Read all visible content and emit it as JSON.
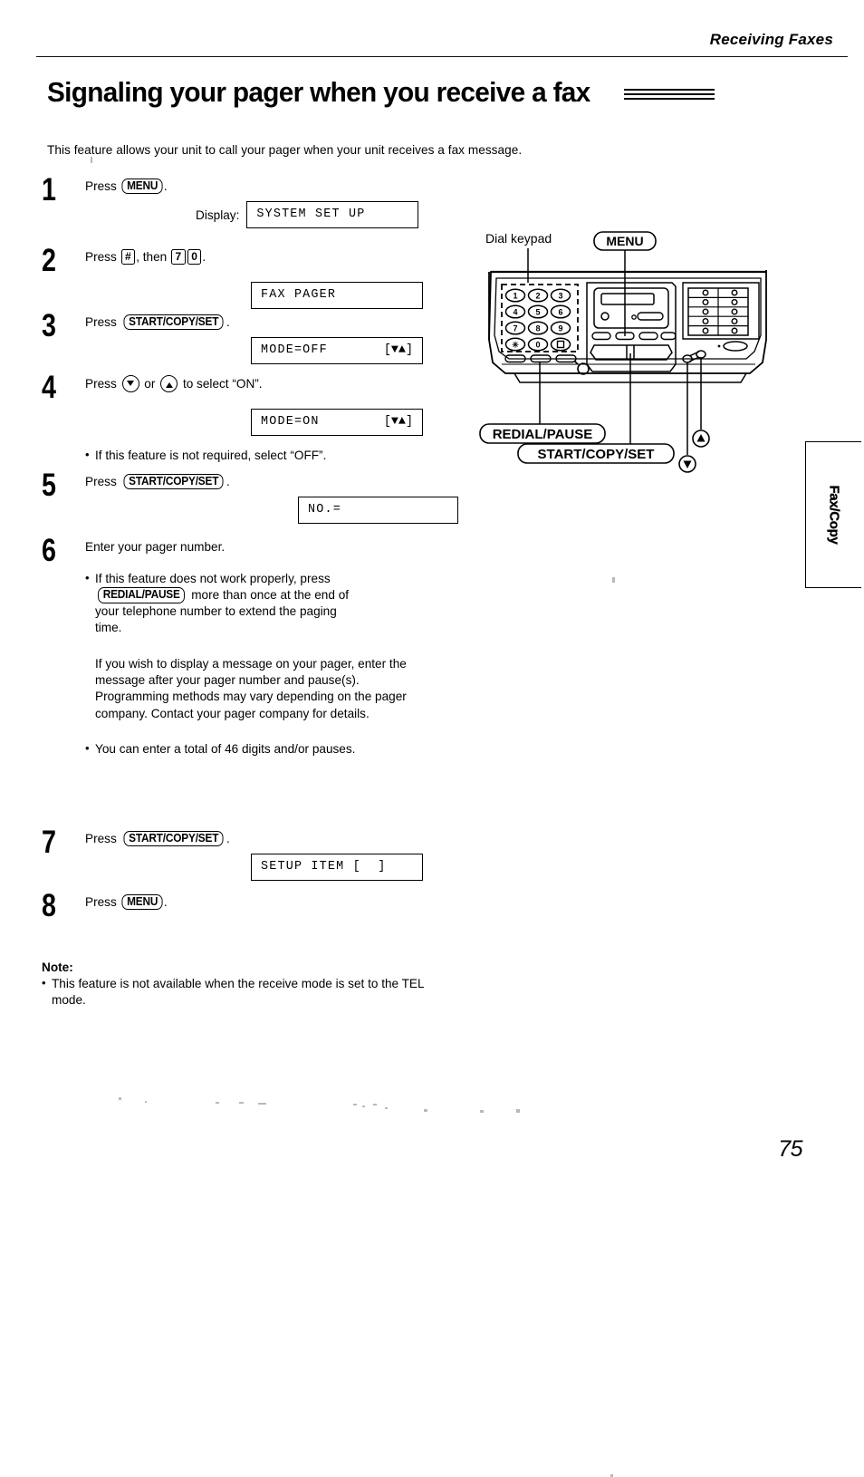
{
  "header": {
    "section_title": "Receiving Faxes"
  },
  "title": "Signaling your pager when you receive a fax",
  "intro": "This feature allows your unit to call your pager when your unit receives a fax message.",
  "steps": [
    {
      "number": "1",
      "text_before": "Press ",
      "key": "MENU",
      "text_after": ".",
      "display_label": "Display:",
      "lcd": "SYSTEM SET UP",
      "lcd_right": ""
    },
    {
      "number": "2",
      "text_before": "Press ",
      "key_small_1": "#",
      "text_mid": ", then ",
      "key_small_2": "7",
      "key_small_3": "0",
      "text_after": ".",
      "lcd": "FAX PAGER",
      "lcd_right": ""
    },
    {
      "number": "3",
      "text_before": "Press ",
      "key": "START/COPY/SET",
      "text_after": ".",
      "lcd": "MODE=OFF",
      "lcd_right": "[▼▲]"
    },
    {
      "number": "4",
      "text_before": "Press ",
      "arrow_down": "down-arrow",
      "text_mid": " or ",
      "arrow_up": "up-arrow",
      "text_after": " to select “ON”.",
      "lcd": "MODE=ON",
      "lcd_right": "[▼▲]",
      "bullet": "If this feature is not required, select “OFF”."
    },
    {
      "number": "5",
      "text_before": "Press ",
      "key": "START/COPY/SET",
      "text_after": ".",
      "lcd": "NO.=",
      "lcd_right": ""
    },
    {
      "number": "6",
      "text_before": "Enter your pager number.",
      "bullet_line_1": "If this feature does not work properly, press",
      "bullet_key": "REDIAL/PAUSE",
      "bullet_line_2": " more than once at the end of",
      "bullet_line_3": "your telephone number to extend the paging",
      "bullet_line_4": "time.",
      "paragraph": "If you wish to display a message on your pager, enter the message after your pager number and pause(s).\nProgramming methods may vary depending on the pager company. Contact your pager company for details.",
      "bullet_2": "You can enter a total of 46 digits and/or pauses."
    },
    {
      "number": "7",
      "text_before": "Press ",
      "key": "START/COPY/SET",
      "text_after": ".",
      "lcd": "SETUP ITEM [  ]",
      "lcd_right": ""
    },
    {
      "number": "8",
      "text_before": "Press ",
      "key": "MENU",
      "text_after": "."
    }
  ],
  "note": {
    "title": "Note:",
    "bullet": "This feature is not available when the receive mode is set to the TEL mode."
  },
  "diagram": {
    "label_dial_keypad": "Dial keypad",
    "label_menu": "MENU",
    "label_redial_pause": "REDIAL/PAUSE",
    "label_start_copy_set": "START/COPY/SET",
    "keypad_keys": [
      "1",
      "2",
      "3",
      "4",
      "5",
      "6",
      "7",
      "8",
      "9",
      "∗",
      "0",
      "□"
    ]
  },
  "side_tab": {
    "label": "Fax/Copy"
  },
  "page_number": "75"
}
